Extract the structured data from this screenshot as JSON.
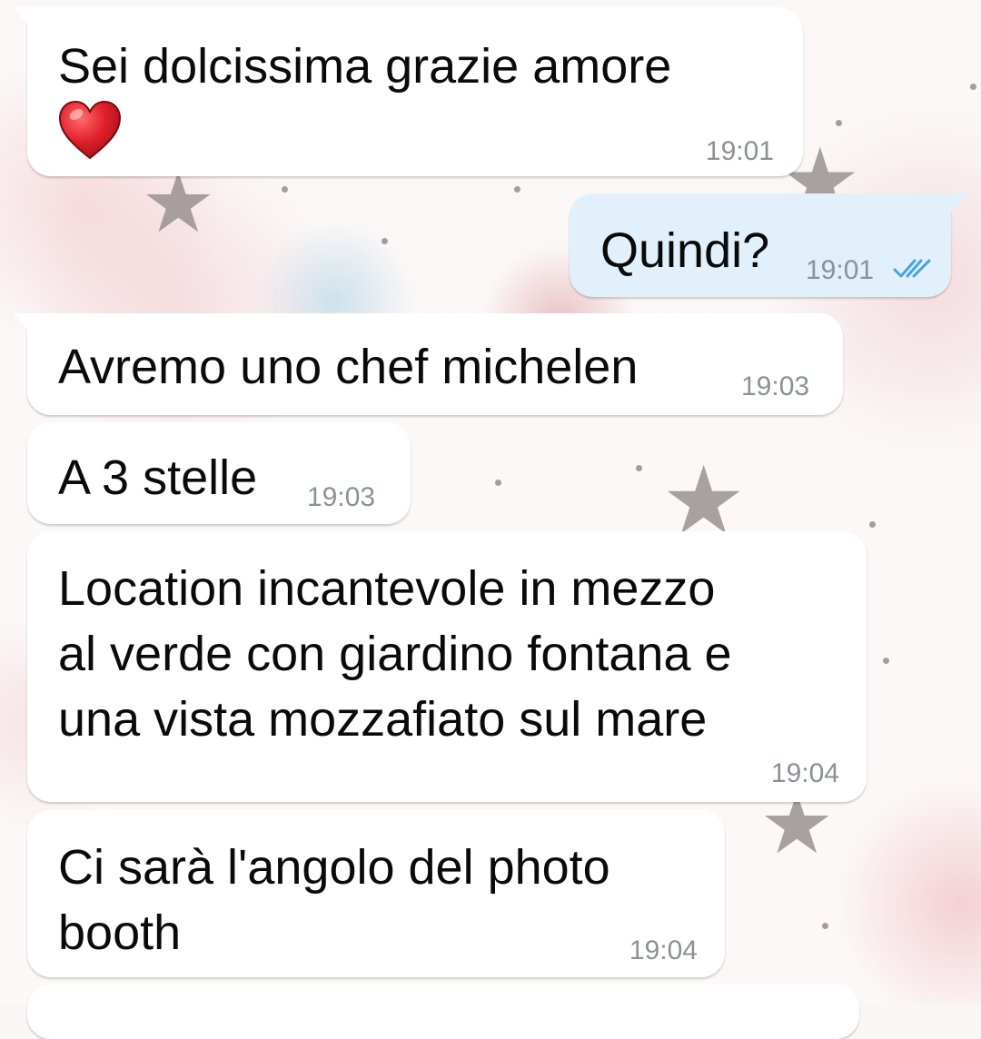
{
  "messages": [
    {
      "id": "m1",
      "direction": "incoming",
      "text": "Sei dolcissima grazie amore",
      "emoji": "heart-emoji",
      "time": "19:01"
    },
    {
      "id": "m2",
      "direction": "outgoing",
      "text": "Quindi?",
      "time": "19:01",
      "status": "read",
      "status_icon": "double-check-icon"
    },
    {
      "id": "m3",
      "direction": "incoming",
      "text": "Avremo uno chef michelen",
      "time": "19:03"
    },
    {
      "id": "m4",
      "direction": "incoming",
      "text": "A 3 stelle",
      "time": "19:03"
    },
    {
      "id": "m5",
      "direction": "incoming",
      "text": "Location incantevole in mezzo al verde con giardino fontana e una vista mozzafiato sul mare",
      "lines": [
        "Location incantevole in mezzo",
        "al verde con giardino fontana e",
        "una vista mozzafiato sul mare"
      ],
      "time": "19:04"
    },
    {
      "id": "m6",
      "direction": "incoming",
      "text": "Ci sarà l'angolo del photo booth",
      "lines": [
        "Ci sarà l'angolo del photo",
        "booth"
      ],
      "time": "19:04"
    }
  ],
  "colors": {
    "incoming_bubble": "#ffffff",
    "outgoing_bubble": "#e1f0fa",
    "timestamp": "#8c9196",
    "read_check": "#4aa3df",
    "heart": "#e0202a"
  }
}
